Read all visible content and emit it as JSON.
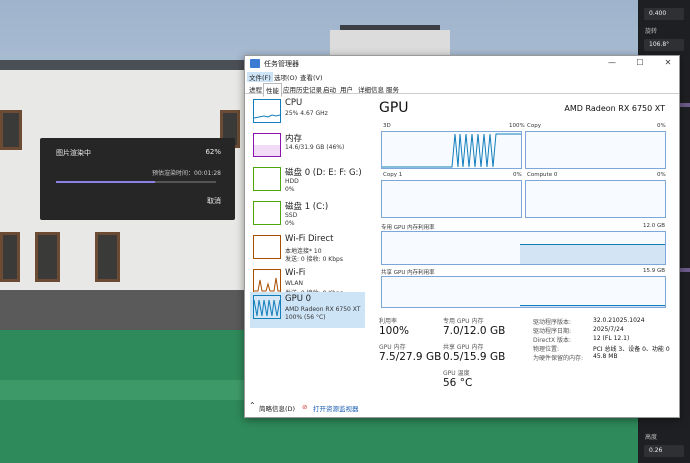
{
  "render_dialog": {
    "title": "图片渲染中",
    "percent": "62%",
    "progress": 0.62,
    "time_label": "预估渲染时间：00:01:28",
    "cancel": "取消"
  },
  "right_panel": {
    "value1": "0.400",
    "label_rotate": "旋转",
    "value2": "106.8°",
    "label_height": "高度",
    "value3": "0.26"
  },
  "taskmanager": {
    "title": "任务管理器",
    "menu": [
      "文件(F)",
      "选项(O)",
      "查看(V)"
    ],
    "tabs": [
      "进程",
      "性能",
      "应用历史记录",
      "启动",
      "用户",
      "详细信息",
      "服务"
    ],
    "sidebar": [
      {
        "name": "CPU",
        "s1": "25% 4.67 GHz",
        "s2": "",
        "color": "#117dbb"
      },
      {
        "name": "内存",
        "s1": "14.6/31.9 GB (46%)",
        "s2": "",
        "color": "#8b12ae"
      },
      {
        "name": "磁盘 0 (D: E: F: G:)",
        "s1": "HDD",
        "s2": "0%",
        "color": "#4da60c"
      },
      {
        "name": "磁盘 1 (C:)",
        "s1": "SSD",
        "s2": "0%",
        "color": "#4da60c"
      },
      {
        "name": "Wi-Fi Direct",
        "s1": "本地连接* 10",
        "s2": "发送: 0 接收: 0 Kbps",
        "color": "#a74f01"
      },
      {
        "name": "Wi-Fi",
        "s1": "WLAN",
        "s2": "发送: 0 接收: 0 Kbps",
        "color": "#a74f01"
      },
      {
        "name": "GPU 0",
        "s1": "AMD Radeon RX 6750 XT",
        "s2": "100% (56 °C)",
        "color": "#117dbb"
      }
    ],
    "gpu": {
      "heading": "GPU",
      "model": "AMD Radeon RX 6750 XT",
      "g1_label": "3D",
      "g1_pct": "100%",
      "g2_label": "Copy",
      "g2_pct": "0%",
      "g3_label": "Copy 1",
      "g3_pct": "0%",
      "g4_label": "Compute 0",
      "g4_pct": "0%",
      "ded_label": "专用 GPU 内存利用率",
      "ded_max": "12.0 GB",
      "shr_label": "共享 GPU 内存利用率",
      "shr_max": "15.9 GB",
      "util_k": "利用率",
      "util_v": "100%",
      "dmem_k": "专用 GPU 内存",
      "dmem_v": "7.0/12.0 GB",
      "gmem_k": "GPU 内存",
      "gmem_v": "7.5/27.9 GB",
      "smem_k": "共享 GPU 内存",
      "smem_v": "0.5/15.9 GB",
      "temp_k": "GPU 温度",
      "temp_v": "56 °C",
      "details": [
        {
          "k": "驱动程序版本:",
          "v": "32.0.21025.1024"
        },
        {
          "k": "驱动程序日期:",
          "v": "2025/7/24"
        },
        {
          "k": "DirectX 版本:",
          "v": "12 (FL 12.1)"
        },
        {
          "k": "物理位置:",
          "v": "PCI 总线 3、设备 0、功能 0"
        },
        {
          "k": "为硬件保留的内存:",
          "v": "45.8 MB"
        }
      ]
    },
    "footer": {
      "brief": "简略信息(D)",
      "monitor": "打开资源监视器"
    }
  }
}
